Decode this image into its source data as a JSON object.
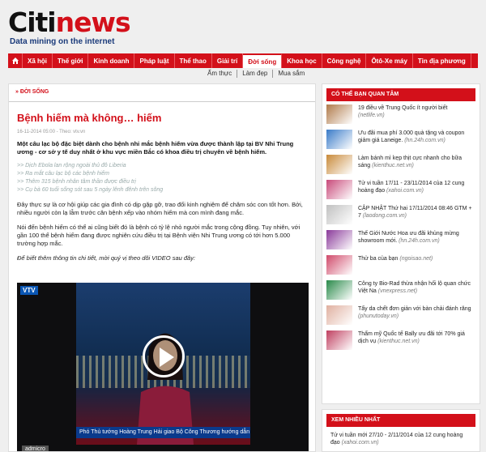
{
  "logo": {
    "tagline": "Data mining on the internet",
    "brand_c": "Citi",
    "brand_n": "news"
  },
  "nav": {
    "items": [
      "Xã hội",
      "Thế giới",
      "Kinh doanh",
      "Pháp luật",
      "Thể thao",
      "Giải trí",
      "Đời sống",
      "Khoa học",
      "Công nghệ",
      "Ôtô-Xe máy",
      "Tin địa phương"
    ],
    "active_index": 6
  },
  "subnav": [
    "Ẩm thực",
    "Làm đẹp",
    "Mua sắm"
  ],
  "section": {
    "label": "» ĐỜI SỐNG"
  },
  "article": {
    "title": "Bệnh hiếm mà không… hiếm",
    "meta": "16-11-2014 05:00 - Theo: vtv.vn",
    "lead": "Một câu lạc bộ đặc biệt dành cho bệnh nhi mắc bệnh hiếm vừa được thành lập tại BV Nhi Trung ương - cơ sở y tế duy nhất ở khu vực miền Bắc có khoa điều trị chuyên về bệnh hiếm.",
    "related": [
      ">> Dịch Ebola lan rộng ngoài thủ đô Liberia",
      ">> Ra mắt câu lạc bộ các bệnh hiếm",
      ">> Thêm 315 bệnh nhân tâm thần được điều trị",
      ">> Cụ bà 60 tuổi sống sót sau 5 ngày lênh đênh trên sông"
    ],
    "para1": "Đây thực sự là cơ hội giúp các gia đình có dịp gặp gỡ, trao đổi kinh nghiệm để chăm sóc con tốt hơn. Bởi, nhiều người còn lạ lẫm trước căn bệnh xếp vào nhóm hiếm mà con mình đang mắc.",
    "para2": "Nói đến bệnh hiếm có thể ai cũng biết đó là bệnh có tỷ lệ nhỏ người mắc trong cộng đồng. Tuy nhiên, với gần 100 thể bệnh hiếm đang được nghiên cứu điều trị tại Bệnh viện Nhi Trung ương có tới hơn 5.000 trường hợp mắc.",
    "para3": "Để biết thêm thông tin chi tiết, mời quý vị theo dõi VIDEO sau đây:"
  },
  "video": {
    "channel": "VTV",
    "ticker": "Phó Thủ tướng Hoàng Trung Hải giao Bộ Công Thương hướng dẫn UBND t",
    "brand": "admicro"
  },
  "sidebar": {
    "heading": "CÓ THỂ BẠN QUAN TÂM",
    "items": [
      {
        "title": "19 điều về Trung Quốc ít người biết",
        "source": "(netlife.vn)",
        "color": "#b07a4a"
      },
      {
        "title": "Ưu đãi mua phí 3.000 quà tặng và coupon giảm giá Laneige.",
        "source": "(hn.24h.com.vn)",
        "color": "#3a7bc8"
      },
      {
        "title": "Làm bánh mì kẹp thịt cực nhanh cho bữa sáng",
        "source": "(kienthuc.net.vn)",
        "color": "#c88a3a"
      },
      {
        "title": "Tử vi tuần 17/11 - 23/11/2014 của 12 cung hoàng đạo",
        "source": "(xahoi.com.vn)",
        "color": "#c84a7a"
      },
      {
        "title": "CẬP NHẬT Thứ hai 17/11/2014 08:46 GTM + 7",
        "source": "(laodong.com.vn)",
        "color": "#c0c0c0"
      },
      {
        "title": "Thế Giới Nước Hoa ưu đãi khủng mừng showroom mới.",
        "source": "(hn.24h.com.vn)",
        "color": "#8a3a9a"
      },
      {
        "title": "Thử ba của bạn",
        "source": "(ngoisao.net)",
        "color": "#d04a6a"
      },
      {
        "title": "Công ty Bio-Rad thừa nhận hối lộ quan chức Việt Na",
        "source": "(vnexpress.net)",
        "color": "#2a8a4a"
      },
      {
        "title": "Tẩy da chết đơn giản với bàn chải đánh răng",
        "source": "(phunutoday.vn)",
        "color": "#e0b0a0"
      },
      {
        "title": "Thẩm mỹ Quốc tế Bally ưu đãi tới 70% giá dịch vụ",
        "source": "(kienthuc.net.vn)",
        "color": "#c04060"
      }
    ]
  },
  "sidebar2": {
    "heading": "XEM NHIỀU NHẤT",
    "item": "Tử vi tuần mới 27/10 - 2/11/2014 của 12 cung hoàng đạo",
    "source": "(xahoi.com.vn)"
  }
}
